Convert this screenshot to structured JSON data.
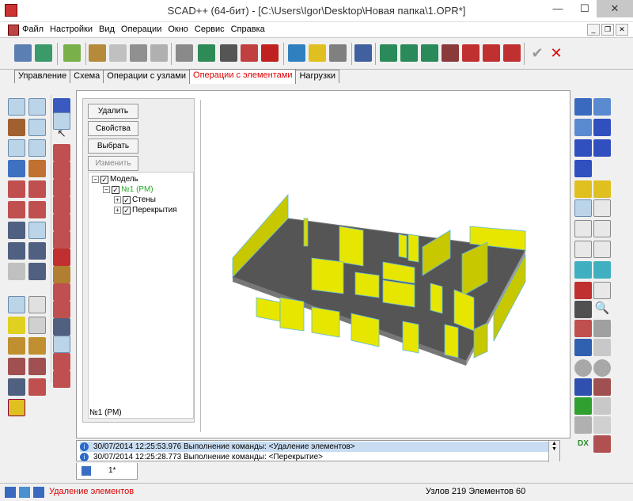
{
  "window": {
    "title": "SCAD++ (64-бит) - [C:\\Users\\Igor\\Desktop\\Новая папка\\1.OPR*]",
    "minimize": "—",
    "maximize": "☐",
    "close": "✕"
  },
  "menu": {
    "items": [
      "Файл",
      "Настройки",
      "Вид",
      "Операции",
      "Окно",
      "Сервис",
      "Справка"
    ],
    "mdi_minimize": "_",
    "mdi_restore": "❐",
    "mdi_close": "✕"
  },
  "tabs": [
    {
      "label": "Управление",
      "active": false
    },
    {
      "label": "Схема",
      "active": false
    },
    {
      "label": "Операции с узлами",
      "active": false
    },
    {
      "label": "Операции с элементами",
      "active": true
    },
    {
      "label": "Нагрузки",
      "active": false
    }
  ],
  "side_panel": {
    "buttons": {
      "delete": "Удалить",
      "properties": "Свойства",
      "select": "Выбрать",
      "change": "Изменить"
    },
    "tree": {
      "root": "Модель",
      "group": "№1 (РМ)",
      "children": [
        "Стены",
        "Перекрытия"
      ]
    },
    "status": "№1 (РМ)"
  },
  "log": {
    "rows": [
      "30/07/2014 12:25:53.976 Выполнение команды: <Удаление элементов>",
      "30/07/2014 12:25:28.773 Выполнение команды: <Перекрытие>"
    ]
  },
  "doc_tab": {
    "label": "1*"
  },
  "status": {
    "message": "Удаление элементов",
    "nodes_elements": "Узлов 219 Элементов 60"
  },
  "colors": {
    "wall": "#e6e600",
    "floor": "#555555",
    "active_tab": "#dd0000",
    "log_selected": "#c8ddf2"
  }
}
